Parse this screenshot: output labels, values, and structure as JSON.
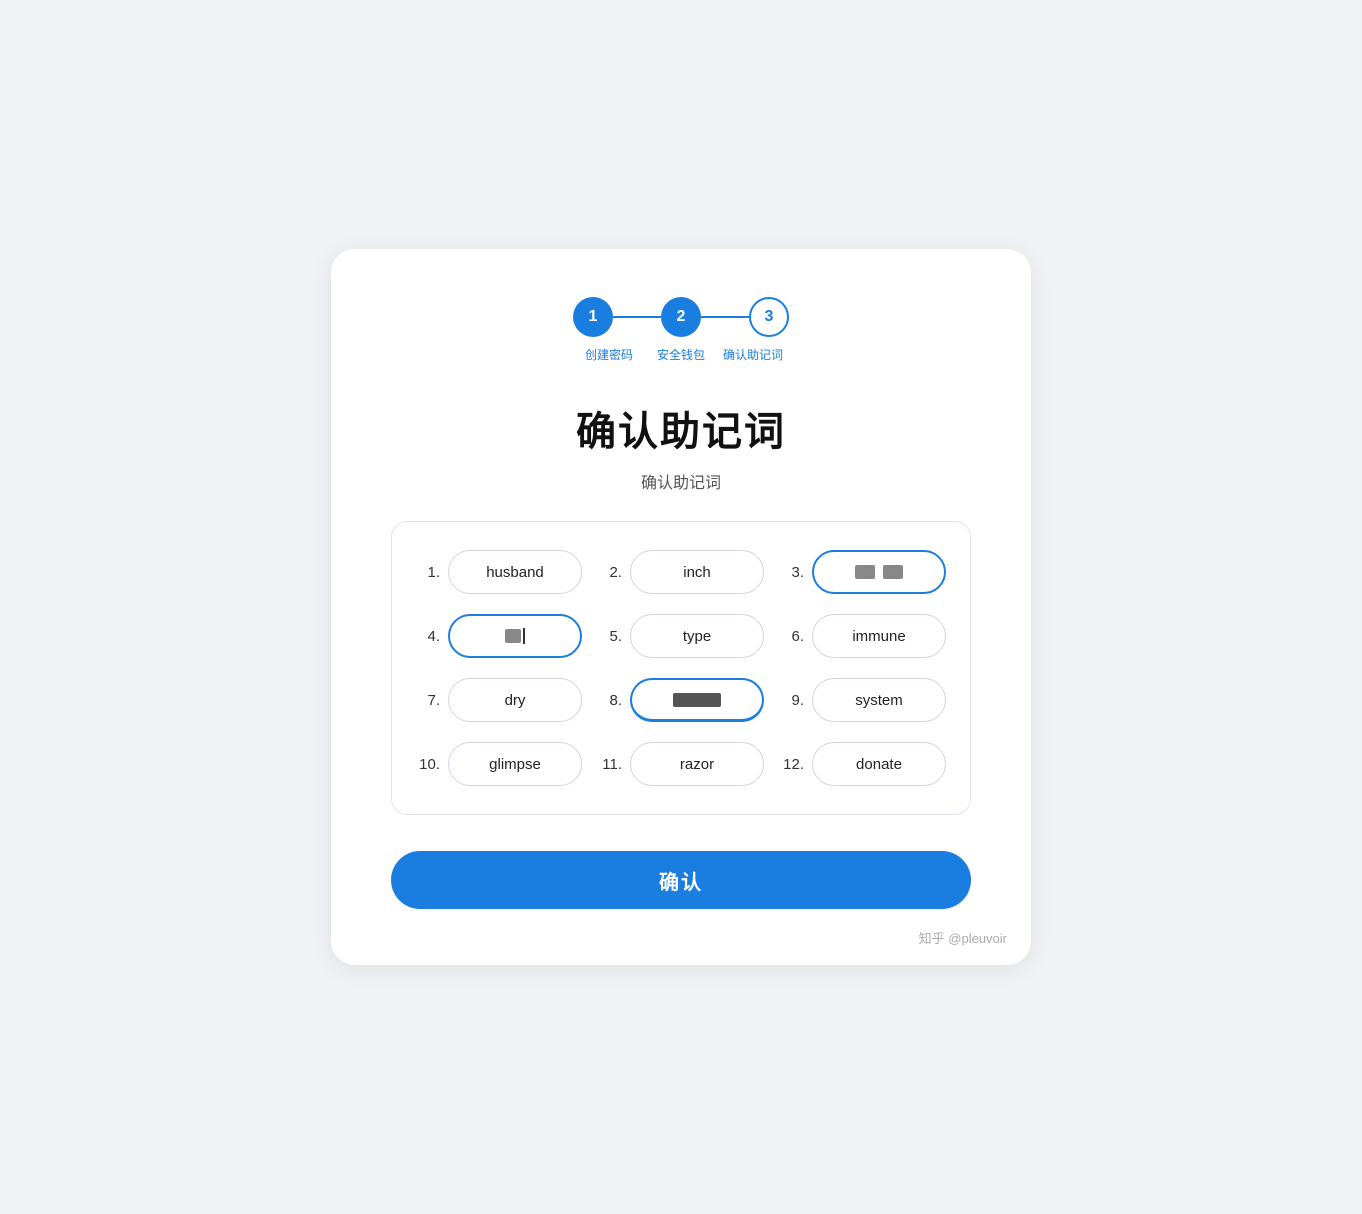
{
  "stepper": {
    "steps": [
      {
        "number": "1",
        "style": "active"
      },
      {
        "number": "2",
        "style": "active"
      },
      {
        "number": "3",
        "style": "outline"
      }
    ],
    "labels": [
      "创建密码",
      "安全钱包",
      "确认助记词"
    ],
    "line_count": 2
  },
  "page": {
    "main_title": "确认助记词",
    "sub_title": "确认助记词",
    "confirm_button": "确认",
    "watermark": "知乎 @pleuvoir"
  },
  "words": [
    {
      "number": "1.",
      "text": "husband",
      "style": "normal"
    },
    {
      "number": "2.",
      "text": "inch",
      "style": "normal"
    },
    {
      "number": "3.",
      "text": "",
      "style": "highlighted-blue",
      "blurred": true,
      "blur_widths": [
        20,
        20
      ]
    },
    {
      "number": "4.",
      "text": "",
      "style": "highlighted-blue",
      "blurred": true,
      "blur_widths": [
        16
      ],
      "cursor": true
    },
    {
      "number": "5.",
      "text": "type",
      "style": "normal"
    },
    {
      "number": "6.",
      "text": "immune",
      "style": "normal"
    },
    {
      "number": "7.",
      "text": "dry",
      "style": "normal"
    },
    {
      "number": "8.",
      "text": "",
      "style": "typing-active",
      "blurred": true,
      "blur_widths": [
        40
      ]
    },
    {
      "number": "9.",
      "text": "system",
      "style": "normal"
    },
    {
      "number": "10.",
      "text": "glimpse",
      "style": "normal"
    },
    {
      "number": "11.",
      "text": "razor",
      "style": "normal"
    },
    {
      "number": "12.",
      "text": "donate",
      "style": "normal"
    }
  ]
}
